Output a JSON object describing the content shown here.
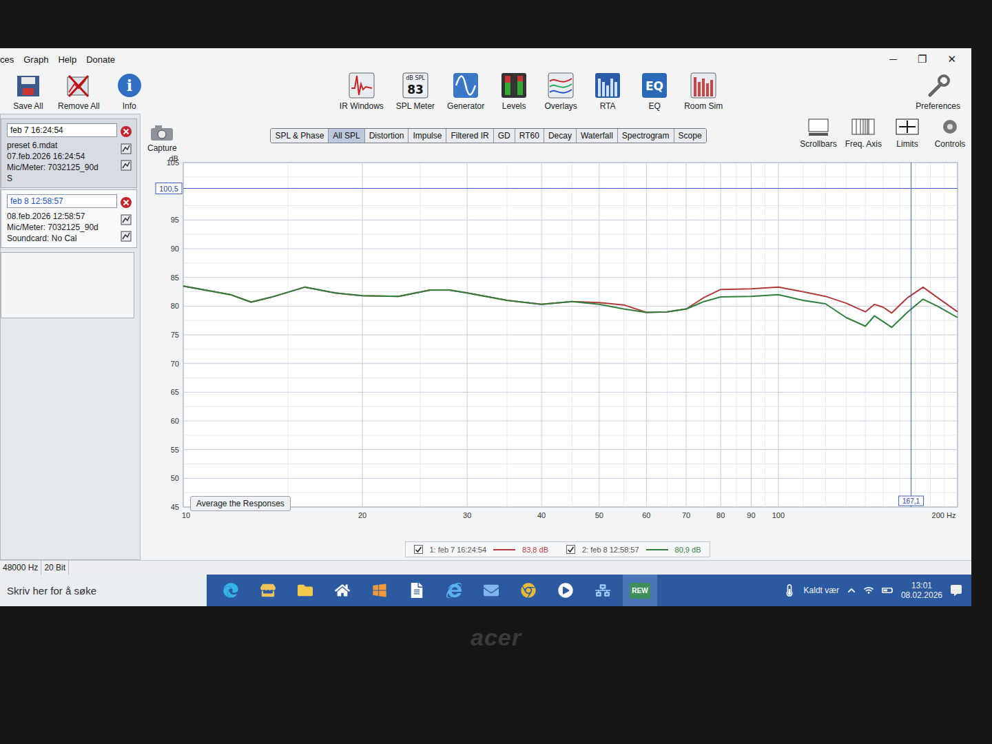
{
  "window": {
    "menu": [
      "ces",
      "Graph",
      "Help",
      "Donate"
    ],
    "controls": [
      "─",
      "❐",
      "✕"
    ]
  },
  "toolbar_left": [
    {
      "label": "Save All",
      "kind": "save",
      "icon_text": []
    },
    {
      "label": "Remove All",
      "kind": "remove",
      "icon_text": []
    },
    {
      "label": "Info",
      "kind": "info",
      "icon_text": [
        "i"
      ]
    }
  ],
  "toolbar_main": [
    {
      "label": "IR Windows",
      "kind": "ir",
      "icon_text": []
    },
    {
      "label": "SPL Meter",
      "kind": "spl",
      "icon_text": [
        "dB SPL",
        "83"
      ]
    },
    {
      "label": "Generator",
      "kind": "generator",
      "icon_text": []
    },
    {
      "label": "Levels",
      "kind": "levels",
      "icon_text": []
    },
    {
      "label": "Overlays",
      "kind": "overlays",
      "icon_text": []
    },
    {
      "label": "RTA",
      "kind": "rta",
      "icon_text": []
    },
    {
      "label": "EQ",
      "kind": "eq",
      "icon_text": [
        "EQ"
      ]
    },
    {
      "label": "Room Sim",
      "kind": "roomsim",
      "icon_text": []
    }
  ],
  "preferences": "Preferences",
  "capture": "Capture",
  "graph_tabs": [
    {
      "label": "SPL & Phase",
      "selected": false
    },
    {
      "label": "All SPL",
      "selected": true
    },
    {
      "label": "Distortion",
      "selected": false
    },
    {
      "label": "Impulse",
      "selected": false
    },
    {
      "label": "Filtered IR",
      "selected": false
    },
    {
      "label": "GD",
      "selected": false
    },
    {
      "label": "RT60",
      "selected": false
    },
    {
      "label": "Decay",
      "selected": false
    },
    {
      "label": "Waterfall",
      "selected": false
    },
    {
      "label": "Spectrogram",
      "selected": false
    },
    {
      "label": "Scope",
      "selected": false
    }
  ],
  "graph_controls": [
    "Scrollbars",
    "Freq. Axis",
    "Limits",
    "Controls"
  ],
  "measurements": [
    {
      "name": "feb 7 16:24:54",
      "lines": [
        "preset 6.mdat",
        "07.feb.2026 16:24:54",
        "Mic/Meter: 7032125_90d",
        "S"
      ],
      "selected": false
    },
    {
      "name": "feb 8 12:58:57",
      "lines": [
        "08.feb.2026 12:58:57",
        "Mic/Meter: 7032125_90d",
        "Soundcard: No Cal"
      ],
      "selected": true
    }
  ],
  "chart": {
    "y_label": "dB",
    "y_min": 45,
    "y_max": 105,
    "x_min": 10,
    "x_max": 200,
    "y_ticks": [
      "105",
      "95",
      "90",
      "85",
      "80",
      "75",
      "70",
      "65",
      "60",
      "55",
      "50",
      "45"
    ],
    "x_ticks": [
      "10",
      "20",
      "30",
      "40",
      "50",
      "60",
      "70",
      "80",
      "90",
      "100",
      "200 Hz"
    ],
    "cursor": {
      "y_value": 100.5,
      "y_label": "100,5",
      "x_value": 167.1,
      "x_label": "167,1"
    },
    "average_button": "Average the Responses",
    "x_values": [
      10,
      12,
      13,
      14,
      16,
      18,
      20,
      23,
      26,
      28,
      30,
      35,
      40,
      45,
      50,
      55,
      60,
      65,
      70,
      75,
      80,
      90,
      100,
      110,
      120,
      130,
      140,
      145,
      150,
      155,
      165,
      175,
      185,
      200
    ],
    "series": [
      {
        "label": "1: feb 7 16:24:54",
        "reading": "83,8 dB",
        "checked": true,
        "color": "#b23a3a",
        "values": [
          83.5,
          82,
          80.7,
          81.5,
          83.3,
          82.3,
          81.8,
          81.7,
          82.8,
          82.8,
          82.3,
          81,
          80.3,
          80.8,
          80.6,
          80.2,
          78.9,
          79,
          79.5,
          81.5,
          82.9,
          83,
          83.3,
          82.5,
          81.7,
          80.5,
          79,
          80.3,
          79.8,
          78.8,
          81.5,
          83.3,
          81.5,
          79
        ]
      },
      {
        "label": "2: feb 8 12:58:57",
        "reading": "80,9 dB",
        "checked": true,
        "color": "#2f7f3a",
        "values": [
          83.5,
          82,
          80.7,
          81.5,
          83.3,
          82.3,
          81.8,
          81.7,
          82.8,
          82.8,
          82.3,
          81,
          80.3,
          80.8,
          80.3,
          79.5,
          78.9,
          79,
          79.5,
          80.8,
          81.6,
          81.7,
          82,
          81,
          80.4,
          78,
          76.5,
          78.3,
          77.3,
          76.3,
          79,
          81.2,
          80,
          78
        ]
      }
    ]
  },
  "status_bar": [
    "48000 Hz",
    "20 Bit"
  ],
  "taskbar": {
    "search_placeholder": "Skriv her for å søke",
    "apps": [
      {
        "kind": "edge",
        "active": false
      },
      {
        "kind": "store",
        "active": false
      },
      {
        "kind": "folder",
        "active": false
      },
      {
        "kind": "home",
        "active": false
      },
      {
        "kind": "office",
        "active": false
      },
      {
        "kind": "file",
        "active": false
      },
      {
        "kind": "ie",
        "active": false
      },
      {
        "kind": "mail",
        "active": false
      },
      {
        "kind": "chrome",
        "active": false
      },
      {
        "kind": "media",
        "active": false
      },
      {
        "kind": "network",
        "active": false
      },
      {
        "kind": "rew",
        "active": true
      }
    ],
    "rew_badge": "REW",
    "weather": "Kaldt vær",
    "time": "13:01",
    "date": "08.02.2026"
  },
  "bezel_logo": "acer"
}
